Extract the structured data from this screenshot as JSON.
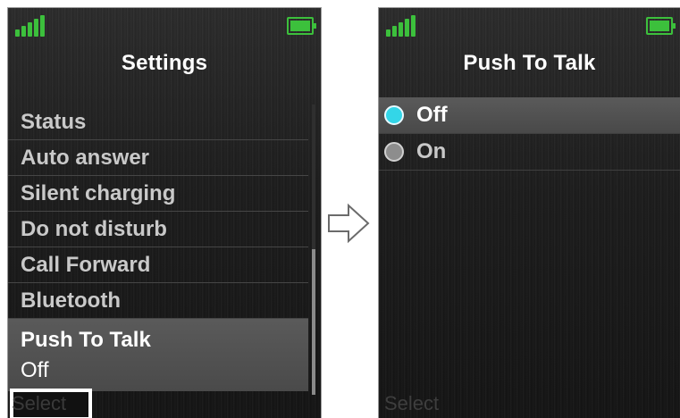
{
  "colors": {
    "signal": "#3cc03c",
    "battery": "#3cc03c",
    "radio_selected": "#33d6e8",
    "radio_unselected": "#8d8d8d",
    "text_primary": "#ffffff",
    "text_muted": "#c9c9c9"
  },
  "left_screen": {
    "title": "Settings",
    "items": [
      {
        "label": "Status"
      },
      {
        "label": "Auto answer"
      },
      {
        "label": "Silent charging"
      },
      {
        "label": "Do not disturb"
      },
      {
        "label": "Call Forward"
      },
      {
        "label": "Bluetooth"
      }
    ],
    "selected_item": {
      "label": "Push To Talk",
      "value": "Off"
    },
    "softkey": "Select",
    "icons": {
      "signal": "signal-strength-icon",
      "battery": "battery-icon"
    }
  },
  "arrow": {
    "icon": "right-arrow-icon"
  },
  "right_screen": {
    "title": "Push To Talk",
    "options": [
      {
        "label": "Off",
        "selected": true
      },
      {
        "label": "On",
        "selected": false
      }
    ],
    "softkey": "Select",
    "icons": {
      "signal": "signal-strength-icon",
      "battery": "battery-icon"
    }
  }
}
